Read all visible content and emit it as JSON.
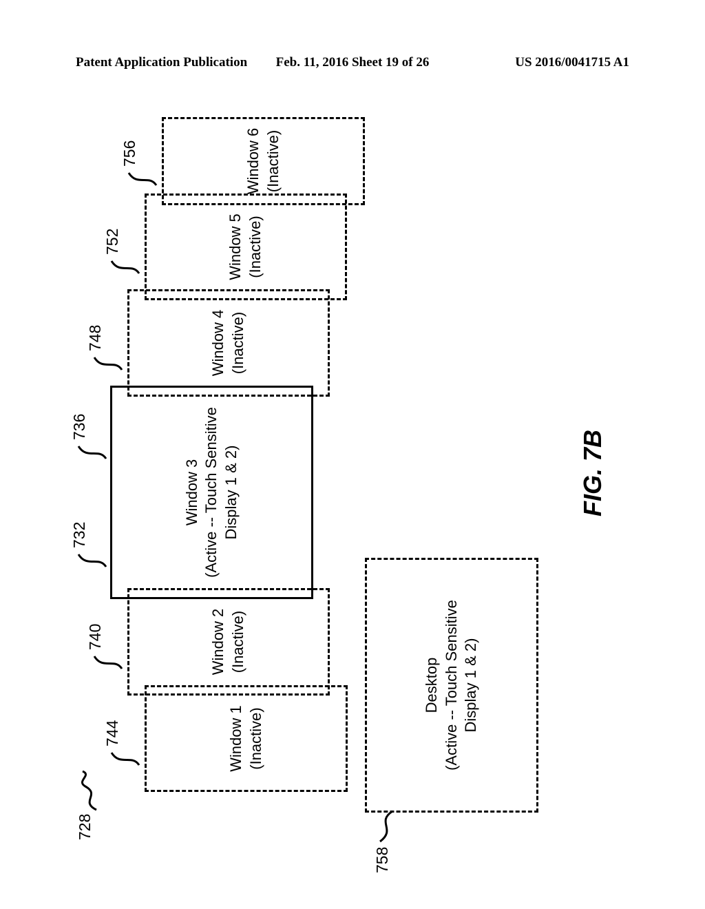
{
  "header": {
    "left": "Patent Application Publication",
    "center": "Feb. 11, 2016  Sheet 19 of 26",
    "right": "US 2016/0041715 A1"
  },
  "figure": {
    "caption": "FIG. 7B",
    "leads": {
      "overall": "728",
      "desktop": "758",
      "w1": "744",
      "w2": "740",
      "w3_left": "732",
      "w3_right": "736",
      "w4": "748",
      "w5": "752",
      "w6": "756"
    },
    "windows": {
      "w1": {
        "line1": "Window 1",
        "line2": "(Inactive)"
      },
      "w2": {
        "line1": "Window 2",
        "line2": "(Inactive)"
      },
      "w3": {
        "line1": "Window 3",
        "line2": "(Active -- Touch Sensitive",
        "line3": "Display 1 & 2)"
      },
      "w4": {
        "line1": "Window 4",
        "line2": "(Inactive)"
      },
      "w5": {
        "line1": "Window 5",
        "line2": "(Inactive)"
      },
      "w6": {
        "line1": "Window 6",
        "line2": "(Inactive)"
      },
      "desk": {
        "line1": "Desktop",
        "line2": "(Active -- Touch Sensitive",
        "line3": "Display 1 & 2)"
      }
    }
  }
}
